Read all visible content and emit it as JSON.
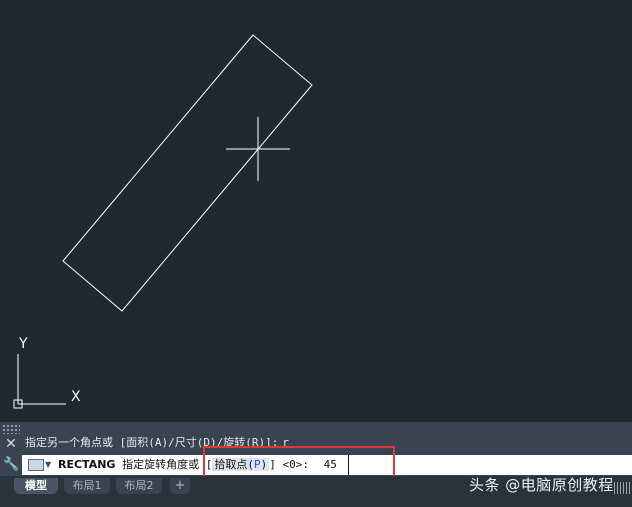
{
  "colors": {
    "canvas_bg": "#212830",
    "drawing_line": "#ffffff",
    "panel_bg": "#3a4350",
    "highlight_border": "#e0383a",
    "option_key": "#2a55c8"
  },
  "icons": {
    "close": "close-icon",
    "wrench": "wrench-icon",
    "command": "command-prompt-icon",
    "ucs": "ucs-icon",
    "crosshair": "crosshair-cursor-icon"
  },
  "canvas": {
    "ucs_y_label": "Y",
    "ucs_x_label": "X"
  },
  "history": {
    "text": "指定另一个角点或 [面积(A)/尺寸(D)/旋转(R)]:",
    "value": "r"
  },
  "command_line": {
    "command_name": "RECTANG",
    "prompt": "指定旋转角度或",
    "option_open": "[",
    "option_label": "拾取点",
    "option_key_open": "(",
    "option_key": "P",
    "option_key_close": ")",
    "option_close": "]",
    "default": "<0>:",
    "input_value": "45"
  },
  "tabs": {
    "model": "模型",
    "layout1": "布局1",
    "layout2": "布局2",
    "add": "+"
  },
  "watermark": "头条 @电脑原创教程"
}
